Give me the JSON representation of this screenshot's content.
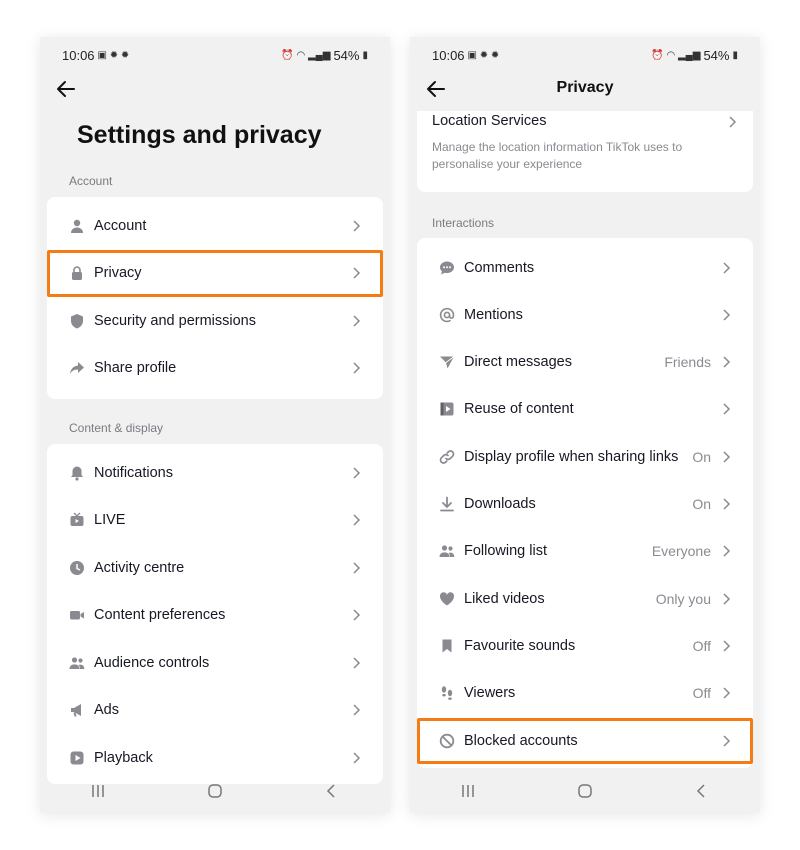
{
  "status_bar": {
    "time": "10:06",
    "battery": "54%"
  },
  "left": {
    "title": "Settings and privacy",
    "account_label": "Account",
    "account_items": [
      {
        "label": "Account",
        "icon": "person-icon"
      },
      {
        "label": "Privacy",
        "icon": "lock-icon"
      },
      {
        "label": "Security and permissions",
        "icon": "shield-icon"
      },
      {
        "label": "Share profile",
        "icon": "share-icon"
      }
    ],
    "content_label": "Content & display",
    "content_items": [
      {
        "label": "Notifications",
        "icon": "bell-icon"
      },
      {
        "label": "LIVE",
        "icon": "tv-icon"
      },
      {
        "label": "Activity centre",
        "icon": "clock-icon"
      },
      {
        "label": "Content preferences",
        "icon": "video-camera-icon"
      },
      {
        "label": "Audience controls",
        "icon": "people-icon"
      },
      {
        "label": "Ads",
        "icon": "megaphone-icon"
      },
      {
        "label": "Playback",
        "icon": "play-icon"
      }
    ]
  },
  "right": {
    "title": "Privacy",
    "location": {
      "title": "Location Services",
      "description": "Manage the location information TikTok uses to personalise your experience"
    },
    "interactions_label": "Interactions",
    "items": [
      {
        "label": "Comments",
        "value": "",
        "icon": "comment-icon"
      },
      {
        "label": "Mentions",
        "value": "",
        "icon": "at-icon"
      },
      {
        "label": "Direct messages",
        "value": "Friends",
        "icon": "send-icon"
      },
      {
        "label": "Reuse of content",
        "value": "",
        "icon": "reuse-icon"
      },
      {
        "label": "Display profile when sharing links",
        "value": "On",
        "icon": "link-icon"
      },
      {
        "label": "Downloads",
        "value": "On",
        "icon": "download-icon"
      },
      {
        "label": "Following list",
        "value": "Everyone",
        "icon": "people-icon"
      },
      {
        "label": "Liked videos",
        "value": "Only you",
        "icon": "heart-icon"
      },
      {
        "label": "Favourite sounds",
        "value": "Off",
        "icon": "bookmark-icon"
      },
      {
        "label": "Viewers",
        "value": "Off",
        "icon": "footprints-icon"
      },
      {
        "label": "Blocked accounts",
        "value": "",
        "icon": "blocked-icon"
      }
    ]
  },
  "colors": {
    "highlight": "#f57c14",
    "icon": "#8a8b91",
    "background": "#f1f1f2"
  }
}
